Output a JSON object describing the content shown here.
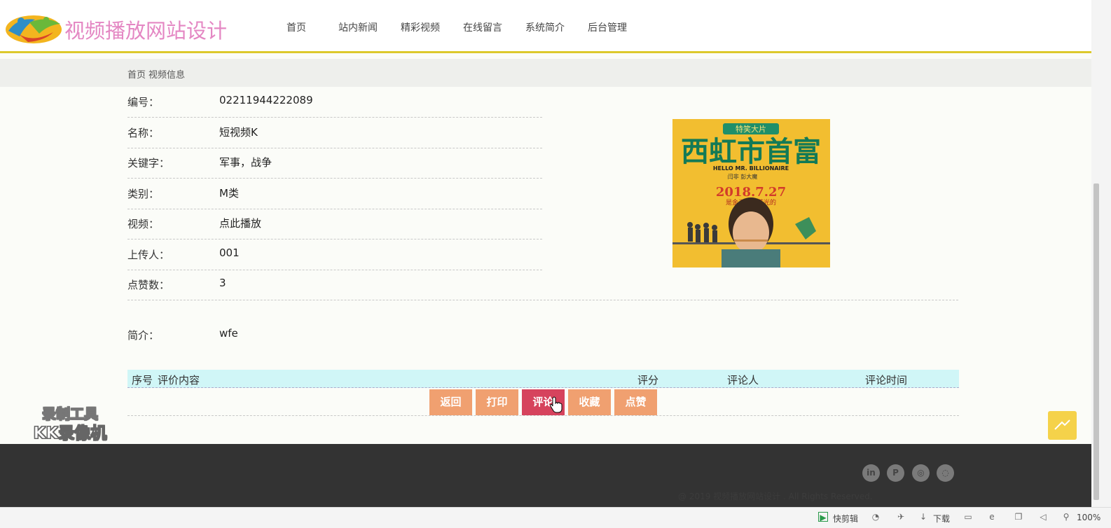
{
  "header": {
    "site_title": "视频播放网站设计",
    "nav": [
      "首页",
      "站内新闻",
      "精彩视频",
      "在线留言",
      "系统简介",
      "后台管理"
    ]
  },
  "breadcrumb": [
    "首页",
    "视频信息"
  ],
  "details": [
    {
      "label": "编号：",
      "value": "02211944222089"
    },
    {
      "label": "名称：",
      "value": "短视频K"
    },
    {
      "label": "关键字：",
      "value": "军事，战争"
    },
    {
      "label": "类别：",
      "value": "M类"
    },
    {
      "label": "视频：",
      "value": "点此播放"
    },
    {
      "label": "上传人：",
      "value": "001"
    },
    {
      "label": "点赞数：",
      "value": "3"
    }
  ],
  "intro": {
    "label": "简介：",
    "value": "wfe"
  },
  "poster": {
    "top_badge": "特笑大片",
    "title": "西虹市首富",
    "subtitle": "HELLO MR. BILLIONAIRE",
    "cast": "闫非 彭大魔",
    "date": "2018.7.27",
    "tagline": "是金子总会花光的"
  },
  "comments_table": {
    "headers": [
      "序号",
      "评价内容",
      "评分",
      "评论人",
      "评论时间"
    ]
  },
  "actions": [
    "返回",
    "打印",
    "评论",
    "收藏",
    "点赞"
  ],
  "watermark": [
    "录制工具",
    "KK录像机"
  ],
  "footer": {
    "social_icons": [
      "linkedin-icon",
      "pinterest-icon",
      "weibo-icon",
      "wechat-icon"
    ],
    "copyright": "@ 2019 视频播放网站设计 . All Rights Reserved."
  },
  "statusbar": {
    "quick_cut": "快剪辑",
    "download": "下载",
    "zoom": "100%"
  },
  "colors": {
    "accent_yellow": "#ddc92b",
    "button": "#f0a070",
    "button_active": "#d6435d",
    "table_header": "#d0f6f7",
    "title_pink": "#e487c3"
  }
}
